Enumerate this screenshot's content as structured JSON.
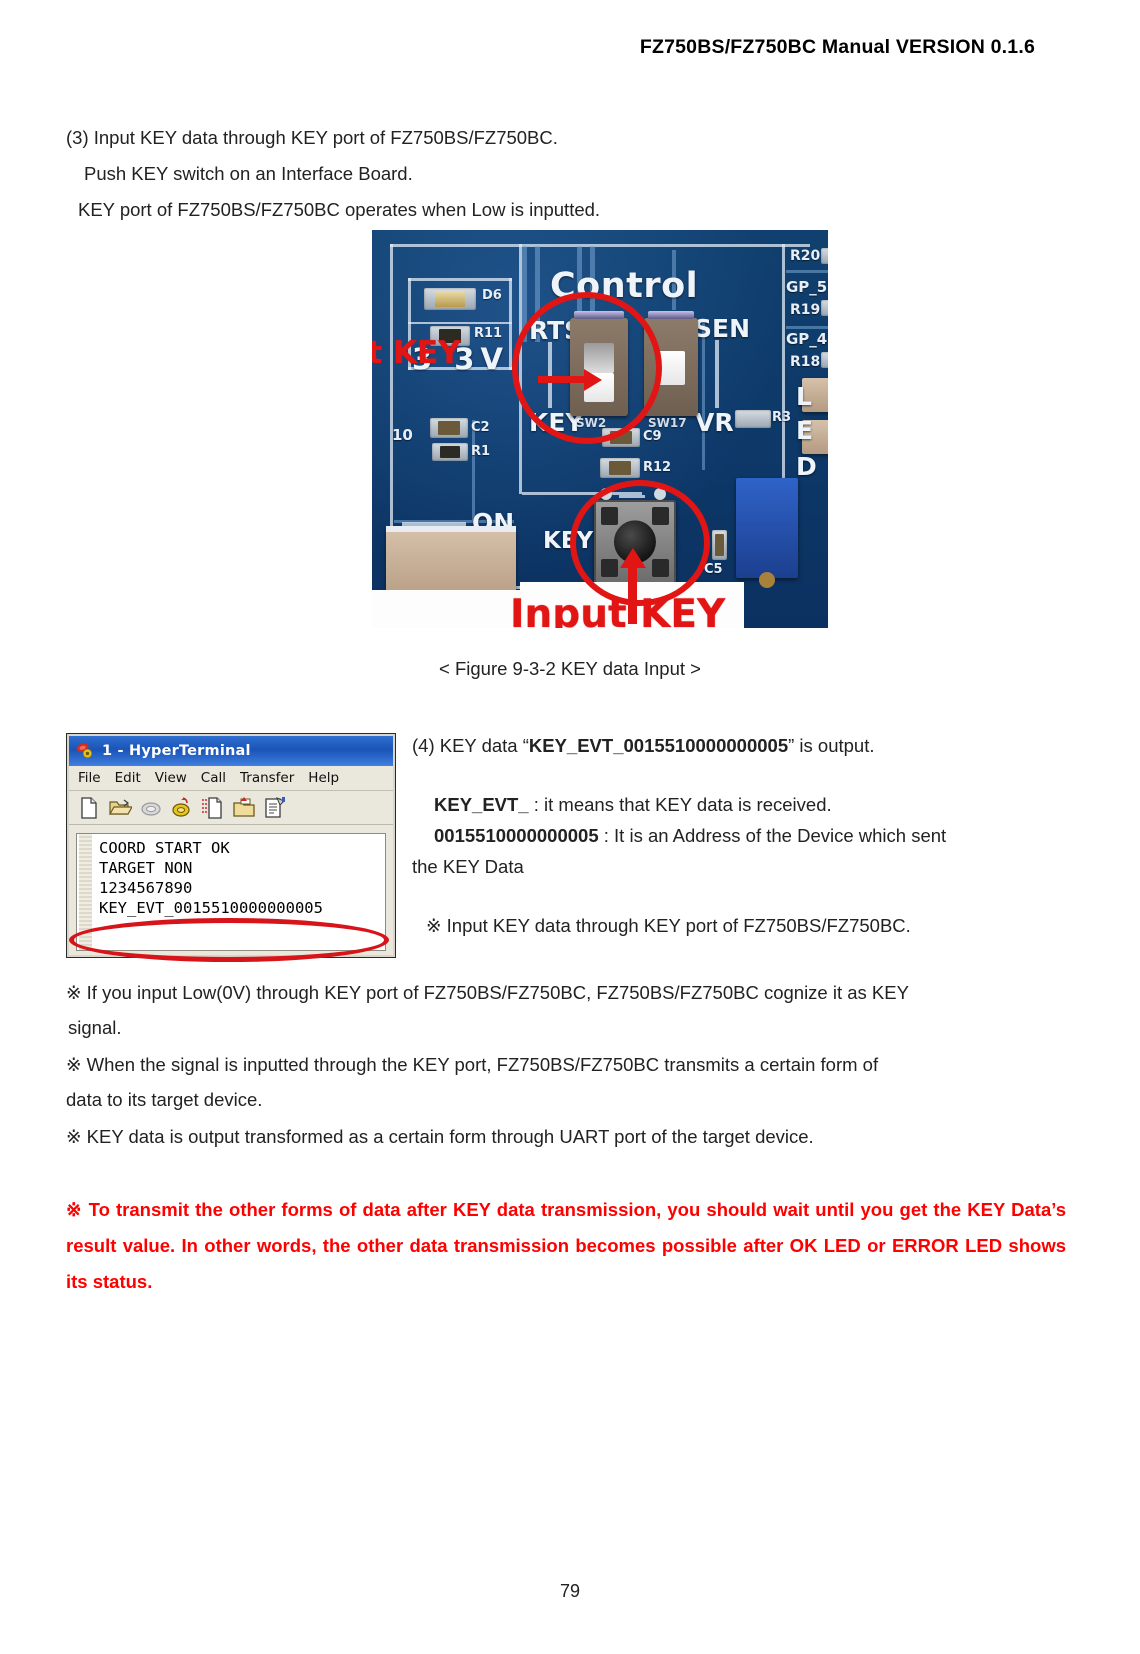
{
  "header": {
    "title": "FZ750BS/FZ750BC Manual VERSION 0.1.6"
  },
  "intro": {
    "line1": "(3) Input KEY data through KEY port of FZ750BS/FZ750BC.",
    "line2": "Push KEY switch on an Interface Board.",
    "line3": "KEY port of FZ750BS/FZ750BC operates when Low is inputted."
  },
  "figure": {
    "caption": "< Figure 9-3-2 KEY data Input >",
    "annotations": {
      "select_key": "Select KEY",
      "input_key": "Input KEY"
    },
    "board_labels": {
      "control": "Control",
      "rts": "RTS",
      "sen": "SEN",
      "key_switch": "KEY",
      "vr": "VR",
      "volt": "3 3V",
      "on": "ON",
      "key_button": "KEY",
      "d6": "D6",
      "r11": "R11",
      "c2": "C2",
      "r1": "R1",
      "c9": "C9",
      "r12": "R12",
      "c5": "C5",
      "r3": "R3",
      "sw2": "SW2",
      "sw17": "SW17",
      "ten": "10",
      "r20": "R20",
      "r19": "R19",
      "r18": "R18",
      "gp5": "GP_5",
      "gp4": "GP_4",
      "led_l": "L",
      "led_e": "E",
      "led_d": "D"
    }
  },
  "hyperterminal": {
    "title": "1 - HyperTerminal",
    "menus": [
      "File",
      "Edit",
      "View",
      "Call",
      "Transfer",
      "Help"
    ],
    "toolbar_icons": [
      "new-connection-icon",
      "open-icon",
      "disconnect-icon",
      "call-icon",
      "send-file-icon",
      "receive-file-icon",
      "properties-icon"
    ],
    "terminal_lines": [
      "COORD START OK",
      "TARGET NON",
      "1234567890",
      "KEY_EVT_0015510000000005"
    ],
    "highlighted_line_index": 3
  },
  "right_column": {
    "item4_prefix": "(4) KEY data “",
    "item4_code": "KEY_EVT_0015510000000005",
    "item4_suffix": "” is output.",
    "def1_term": "KEY_EVT_",
    "def1_desc": " : it means that KEY data is received.",
    "def2_term": "0015510000000005",
    "def2_desc": " : It is an Address of the Device which sent",
    "def2_cont": "the KEY Data",
    "note_inline": "※  Input KEY data through KEY port of FZ750BS/FZ750BC."
  },
  "notes": [
    {
      "mark": "※",
      "text": "If you input Low(0V) through KEY port of FZ750BS/FZ750BC, FZ750BS/FZ750BC cognize it as KEY",
      "cont": "signal."
    },
    {
      "mark": "※",
      "text": "When the signal is inputted through the KEY port, FZ750BS/FZ750BC transmits a certain form of",
      "cont": "data to its target device."
    },
    {
      "mark": "※",
      "text": "KEY data is output transformed as a certain form through UART port of the target device.",
      "cont": ""
    }
  ],
  "warning": {
    "mark": "※",
    "line1": "To transmit the other forms of data after KEY data transmission, you should wait until you get the",
    "line2": "KEY Data’s result value. In other words, the other data transmission becomes possible after OK LED or",
    "line3": "ERROR LED shows its status.",
    "color": "#ff0000"
  },
  "footer": {
    "page_number": "79"
  }
}
